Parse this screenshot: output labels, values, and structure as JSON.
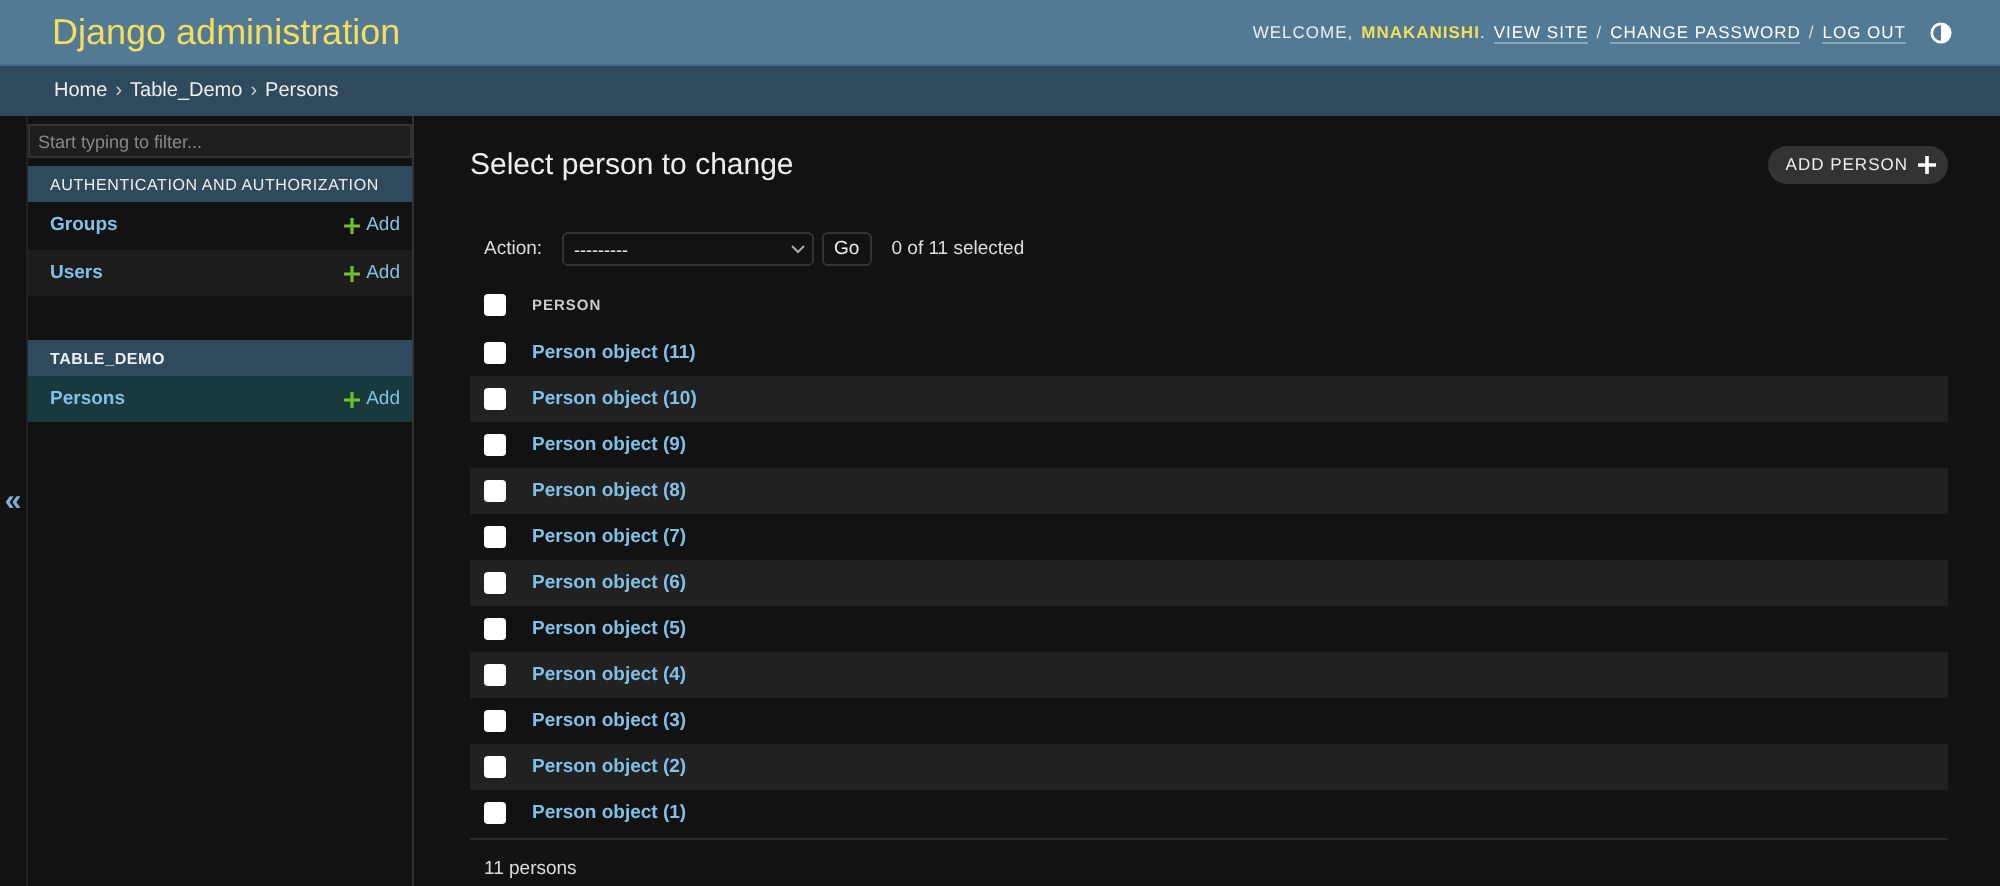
{
  "header": {
    "title": "Django administration",
    "welcome": "WELCOME,",
    "username": "MNAKANISHI",
    "username_suffix": ".",
    "links": [
      "VIEW SITE",
      "CHANGE PASSWORD",
      "LOG OUT"
    ],
    "separator": "/"
  },
  "breadcrumbs": {
    "items": [
      "Home",
      "Table_Demo",
      "Persons"
    ],
    "separator": "›"
  },
  "sidebar": {
    "filter_placeholder": "Start typing to filter...",
    "collapse_toggle": "«",
    "apps": [
      {
        "name": "AUTHENTICATION AND AUTHORIZATION",
        "items": [
          {
            "name": "Groups",
            "add": "Add",
            "selected": false
          },
          {
            "name": "Users",
            "add": "Add",
            "selected": false
          }
        ]
      },
      {
        "name": "TABLE_DEMO",
        "items": [
          {
            "name": "Persons",
            "add": "Add",
            "selected": true
          }
        ]
      }
    ]
  },
  "content": {
    "title": "Select person to change",
    "add_button": "ADD PERSON",
    "action_label": "Action:",
    "action_value": "---------",
    "go_button": "Go",
    "counter": "0 of 11 selected",
    "column": "PERSON",
    "select_all_checked": false,
    "rows": [
      {
        "label": "Person object (11)",
        "checked": false
      },
      {
        "label": "Person object (10)",
        "checked": false
      },
      {
        "label": "Person object (9)",
        "checked": false
      },
      {
        "label": "Person object (8)",
        "checked": false
      },
      {
        "label": "Person object (7)",
        "checked": false
      },
      {
        "label": "Person object (6)",
        "checked": false
      },
      {
        "label": "Person object (5)",
        "checked": false
      },
      {
        "label": "Person object (4)",
        "checked": false
      },
      {
        "label": "Person object (3)",
        "checked": false
      },
      {
        "label": "Person object (2)",
        "checked": false
      },
      {
        "label": "Person object (1)",
        "checked": false
      }
    ],
    "footer": "11 persons"
  }
}
